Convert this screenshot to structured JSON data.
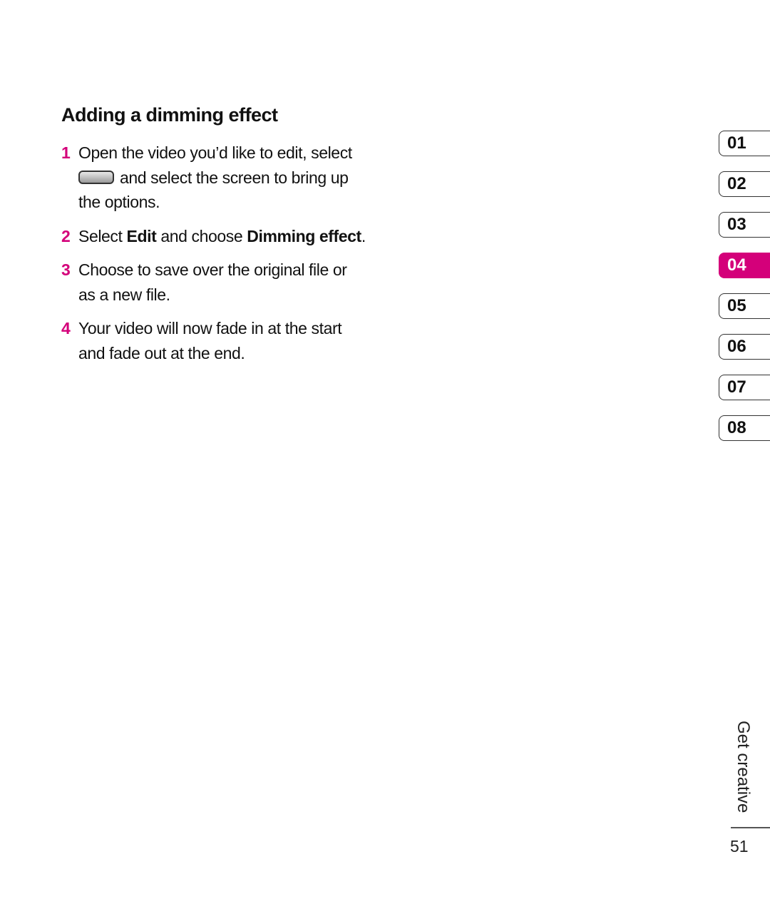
{
  "heading": "Adding a dimming effect",
  "steps": [
    {
      "num": "1",
      "line1": "Open the video you’d like to edit, select",
      "icon": "video-button-icon",
      "line2": "and select the screen to bring up",
      "line3": "the options."
    },
    {
      "num": "2",
      "pre": "Select ",
      "bold1": "Edit",
      "mid": " and choose ",
      "bold2": "Dimming effect",
      "post": "."
    },
    {
      "num": "3",
      "text": "Choose to save over the original file or as a new file."
    },
    {
      "num": "4",
      "text": "Your video will now fade in at the start and fade out at the end."
    }
  ],
  "chapter_tabs": [
    {
      "label": "01",
      "active": false
    },
    {
      "label": "02",
      "active": false
    },
    {
      "label": "03",
      "active": false
    },
    {
      "label": "04",
      "active": true
    },
    {
      "label": "05",
      "active": false
    },
    {
      "label": "06",
      "active": false
    },
    {
      "label": "07",
      "active": false
    },
    {
      "label": "08",
      "active": false
    }
  ],
  "section_label": "Get creative",
  "page_number": "51",
  "accent_color": "#d4007a"
}
